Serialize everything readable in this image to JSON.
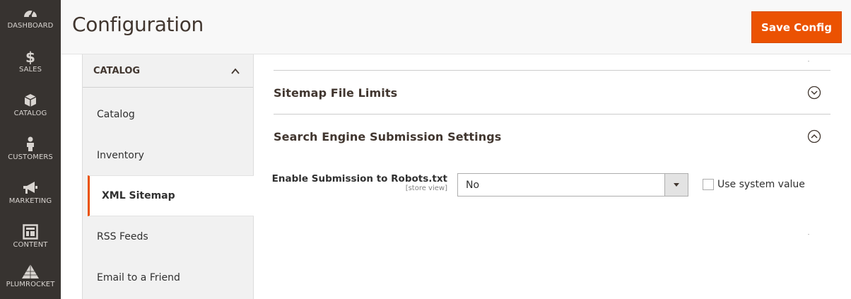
{
  "admin_nav": {
    "items": [
      {
        "label": "DASHBOARD",
        "icon": "dashboard-icon"
      },
      {
        "label": "SALES",
        "icon": "dollar-icon"
      },
      {
        "label": "CATALOG",
        "icon": "cube-icon"
      },
      {
        "label": "CUSTOMERS",
        "icon": "person-icon"
      },
      {
        "label": "MARKETING",
        "icon": "megaphone-icon"
      },
      {
        "label": "CONTENT",
        "icon": "layout-icon"
      },
      {
        "label": "PLUMROCKET",
        "icon": "pyramid-icon"
      }
    ]
  },
  "header": {
    "title": "Configuration",
    "save_label": "Save Config"
  },
  "config_tabs": {
    "group_label": "CATALOG",
    "items": [
      {
        "label": "Catalog"
      },
      {
        "label": "Inventory"
      },
      {
        "label": "XML Sitemap"
      },
      {
        "label": "RSS Feeds"
      },
      {
        "label": "Email to a Friend"
      }
    ],
    "active_item": "XML Sitemap"
  },
  "sections": {
    "sitemap_limits": {
      "title": "Sitemap File Limits",
      "state": "collapsed"
    },
    "search_engine": {
      "title": "Search Engine Submission Settings",
      "state": "expanded"
    }
  },
  "field": {
    "label": "Enable Submission to Robots.txt",
    "scope": "[store view]",
    "value": "No",
    "use_system_label": "Use system value",
    "use_system_checked": false
  },
  "colors": {
    "accent": "#eb5202",
    "nav_bg": "#373330"
  }
}
